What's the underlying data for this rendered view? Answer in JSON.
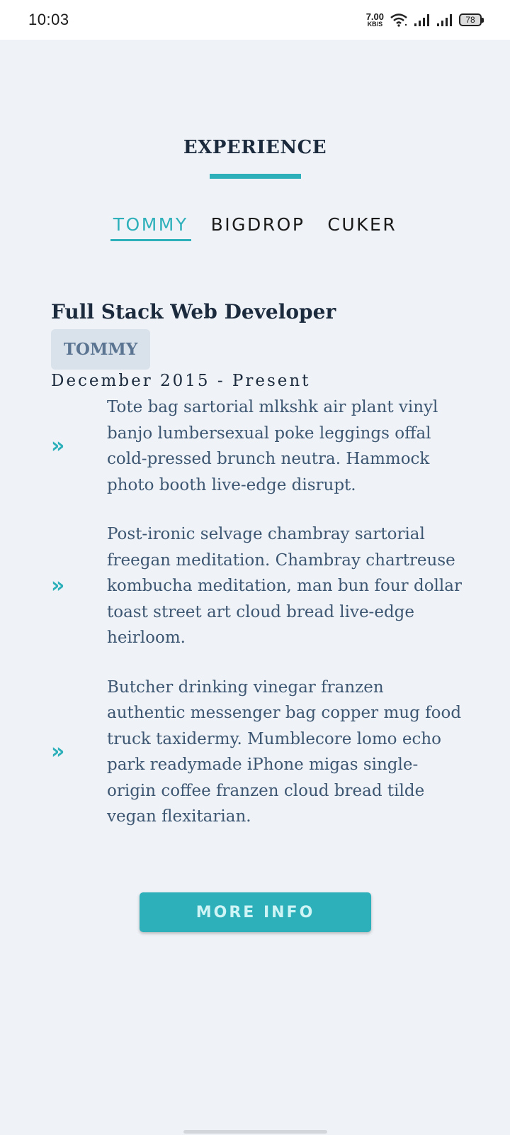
{
  "status_bar": {
    "time": "10:03",
    "net_speed_value": "7.00",
    "net_speed_unit": "KB/S",
    "battery": "78"
  },
  "section": {
    "title": "EXPERIENCE",
    "accent_color": "#2eb0bb"
  },
  "tabs": [
    {
      "label": "TOMMY",
      "active": true
    },
    {
      "label": "BIGDROP",
      "active": false
    },
    {
      "label": "CUKER",
      "active": false
    }
  ],
  "job": {
    "title": "Full Stack Web Developer",
    "company": "TOMMY",
    "dates": "December 2015 - Present",
    "bullet_icon": "double-chevron-right-icon",
    "bullets": [
      "Tote bag sartorial mlkshk air plant vinyl banjo lumbersexual poke leggings offal cold-pressed brunch neutra. Hammock photo booth live-edge disrupt.",
      "Post-ironic selvage chambray sartorial freegan meditation. Chambray chartreuse kombucha meditation, man bun four dollar toast street art cloud bread live-edge heirloom.",
      "Butcher drinking vinegar franzen authentic messenger bag copper mug food truck taxidermy. Mumblecore lomo echo park readymade iPhone migas single-origin coffee franzen cloud bread tilde vegan flexitarian."
    ]
  },
  "more_button": {
    "label": "MORE INFO"
  }
}
